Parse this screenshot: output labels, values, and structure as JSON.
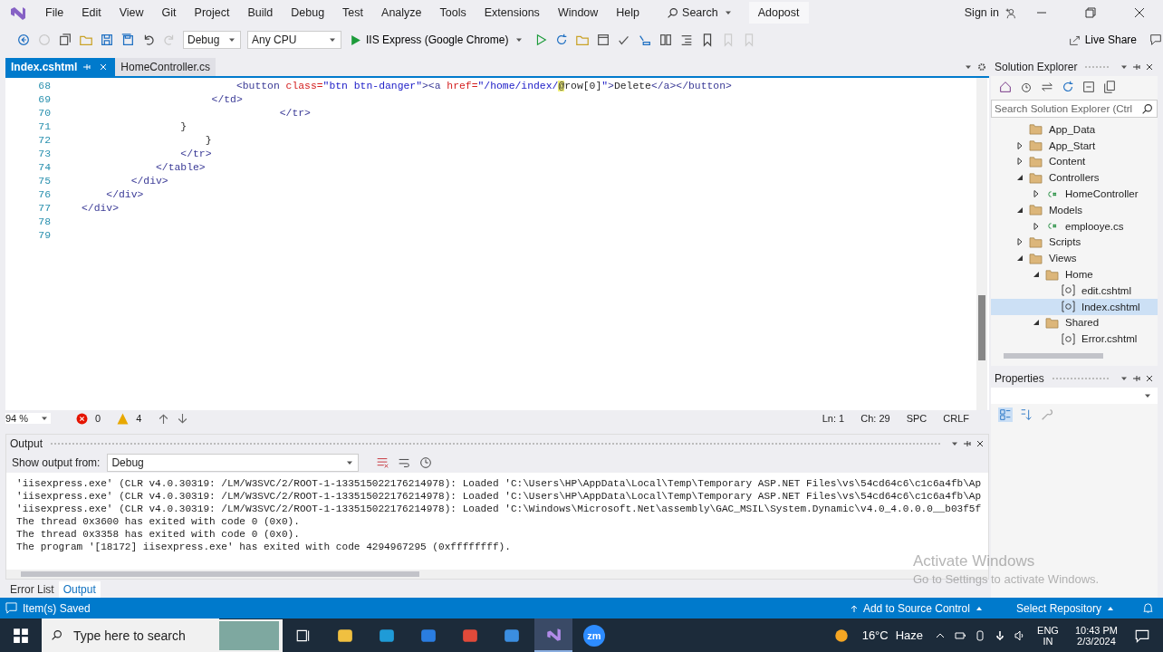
{
  "menu_bar": {
    "items": [
      "File",
      "Edit",
      "View",
      "Git",
      "Project",
      "Build",
      "Debug",
      "Test",
      "Analyze",
      "Tools",
      "Extensions",
      "Window",
      "Help"
    ],
    "search": "Search",
    "solution_name": "Adopost",
    "sign_in": "Sign in"
  },
  "toolbar": {
    "configuration": "Debug",
    "platform": "Any CPU",
    "run_target": "IIS Express (Google Chrome)",
    "live_share": "Live Share"
  },
  "editor": {
    "tabs": [
      {
        "label": "Index.cshtml",
        "selected": true
      },
      {
        "label": "HomeController.cs",
        "selected": false
      }
    ],
    "lines": [
      {
        "number": "68",
        "tokens": [
          {
            "kind": "tag",
            "text": "                         <button"
          },
          {
            "kind": "attr",
            "text": " class="
          },
          {
            "kind": "value",
            "text": "\"btn btn-danger\""
          },
          {
            "kind": "tag",
            "text": "><a"
          },
          {
            "kind": "attr",
            "text": " href="
          },
          {
            "kind": "value",
            "text": "\"/home/index/"
          },
          {
            "kind": "razor",
            "text": "@"
          },
          {
            "kind": "plain",
            "text": "row[0]"
          },
          {
            "kind": "value",
            "text": "\""
          },
          {
            "kind": "tag",
            "text": ">"
          },
          {
            "kind": "plain",
            "text": "Delete"
          },
          {
            "kind": "tag",
            "text": "</a></button>"
          }
        ]
      },
      {
        "number": "69",
        "tokens": [
          {
            "kind": "tag",
            "text": "                     </td>"
          }
        ]
      },
      {
        "number": "70",
        "tokens": [
          {
            "kind": "tag",
            "text": "                                </tr>"
          }
        ]
      },
      {
        "number": "71",
        "tokens": [
          {
            "kind": "plain",
            "text": "                }"
          }
        ]
      },
      {
        "number": "72",
        "tokens": [
          {
            "kind": "plain",
            "text": "                    }"
          }
        ]
      },
      {
        "number": "73",
        "tokens": [
          {
            "kind": "tag",
            "text": "                </tr>"
          }
        ]
      },
      {
        "number": "74",
        "tokens": [
          {
            "kind": "tag",
            "text": "            </table>"
          }
        ]
      },
      {
        "number": "75",
        "tokens": [
          {
            "kind": "tag",
            "text": "        </div>"
          }
        ]
      },
      {
        "number": "76",
        "tokens": [
          {
            "kind": "tag",
            "text": "    </div>"
          }
        ]
      },
      {
        "number": "77",
        "tokens": [
          {
            "kind": "tag",
            "text": "</div>"
          }
        ]
      },
      {
        "number": "78"
      },
      {
        "number": "79"
      }
    ],
    "status": {
      "zoom": "94 %",
      "errors": "0",
      "warnings": "4",
      "line": "Ln: 1",
      "column": "Ch: 29",
      "indent": "SPC",
      "line_endings": "CRLF"
    }
  },
  "output": {
    "title": "Output",
    "source_label": "Show output from:",
    "source": "Debug",
    "lines": [
      "'iisexpress.exe' (CLR v4.0.30319: /LM/W3SVC/2/ROOT-1-133515022176214978): Loaded 'C:\\Users\\HP\\AppData\\Local\\Temp\\Temporary ASP.NET Files\\vs\\54cd64c6\\c1c6a4fb\\Ap",
      "'iisexpress.exe' (CLR v4.0.30319: /LM/W3SVC/2/ROOT-1-133515022176214978): Loaded 'C:\\Users\\HP\\AppData\\Local\\Temp\\Temporary ASP.NET Files\\vs\\54cd64c6\\c1c6a4fb\\Ap",
      "'iisexpress.exe' (CLR v4.0.30319: /LM/W3SVC/2/ROOT-1-133515022176214978): Loaded 'C:\\Windows\\Microsoft.Net\\assembly\\GAC_MSIL\\System.Dynamic\\v4.0_4.0.0.0__b03f5f",
      "The thread 0x3600 has exited with code 0 (0x0).",
      "The thread 0x3358 has exited with code 0 (0x0).",
      "The program '[18172] iisexpress.exe' has exited with code 4294967295 (0xffffffff)."
    ]
  },
  "bottom_tabs": [
    {
      "label": "Error List",
      "selected": false
    },
    {
      "label": "Output",
      "selected": true
    }
  ],
  "solution_explorer": {
    "title": "Solution Explorer",
    "search_placeholder": "Search Solution Explorer (Ctrl",
    "tree": [
      {
        "label": "App_Data",
        "kind": "folder",
        "selected": false
      },
      {
        "label": "App_Start",
        "kind": "folder",
        "expanded": false,
        "selected": false
      },
      {
        "label": "Content",
        "kind": "folder",
        "expanded": false,
        "selected": false
      },
      {
        "label": "Controllers",
        "kind": "folder",
        "expanded": true,
        "selected": false,
        "children": [
          {
            "label": "HomeController",
            "kind": "cs",
            "expanded": false,
            "selected": false
          }
        ]
      },
      {
        "label": "Models",
        "kind": "folder",
        "expanded": true,
        "selected": false,
        "children": [
          {
            "label": "emplooye.cs",
            "kind": "cs",
            "expanded": false,
            "selected": false
          }
        ]
      },
      {
        "label": "Scripts",
        "kind": "folder",
        "expanded": false,
        "selected": false
      },
      {
        "label": "Views",
        "kind": "folder",
        "expanded": true,
        "selected": false,
        "children": [
          {
            "label": "Home",
            "kind": "folder",
            "expanded": true,
            "selected": false,
            "children": [
              {
                "label": "edit.cshtml",
                "kind": "cshtml",
                "selected": false
              },
              {
                "label": "Index.cshtml",
                "kind": "cshtml",
                "selected": true
              }
            ]
          },
          {
            "label": "Shared",
            "kind": "folder",
            "expanded": true,
            "selected": false,
            "children": [
              {
                "label": "Error.cshtml",
                "kind": "cshtml",
                "selected": false
              }
            ]
          }
        ]
      }
    ]
  },
  "properties": {
    "title": "Properties"
  },
  "status_bar": {
    "message": "Item(s) Saved",
    "source_control": "Add to Source Control",
    "repository": "Select Repository"
  },
  "activation_notice": {
    "title": "Activate Windows",
    "hint": "Go to Settings to activate Windows."
  },
  "taskbar": {
    "search_placeholder": "Type here to search",
    "zoom_label": "zm",
    "temperature": "16°C",
    "weather": "Haze",
    "language": "ENG",
    "region": "IN",
    "time": "10:43 PM",
    "date": "2/3/2024"
  }
}
